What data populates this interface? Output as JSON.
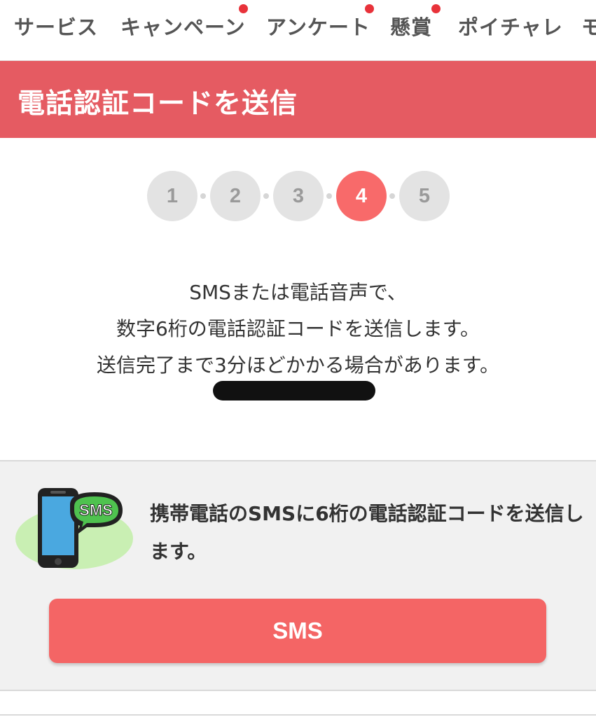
{
  "nav": {
    "items": [
      {
        "label": "サービス",
        "dot": false
      },
      {
        "label": "キャンペーン",
        "dot": true
      },
      {
        "label": "アンケート",
        "dot": true
      },
      {
        "label": "懸賞",
        "dot": true
      },
      {
        "label": "ポイチャレ",
        "dot": false
      },
      {
        "label": "モ",
        "dot": false
      }
    ],
    "dot_color": "#e8323a"
  },
  "header": {
    "title": "電話認証コードを送信",
    "color": "#e55b62"
  },
  "steps": {
    "items": [
      "1",
      "2",
      "3",
      "4",
      "5"
    ],
    "current": 4,
    "active_color": "#f86a6a"
  },
  "description": {
    "lines": [
      "SMSまたは電話音声で、",
      "数字6桁の電話認証コードを送信します。",
      "送信完了まで3分ほどかかる場合があります。"
    ]
  },
  "sms_panel": {
    "icon": "phone-sms-icon",
    "icon_badge": "SMS",
    "text": "携帯電話のSMSに6桁の電話認証コードを送信します。",
    "button_label": "SMS",
    "button_color": "#f46565"
  }
}
